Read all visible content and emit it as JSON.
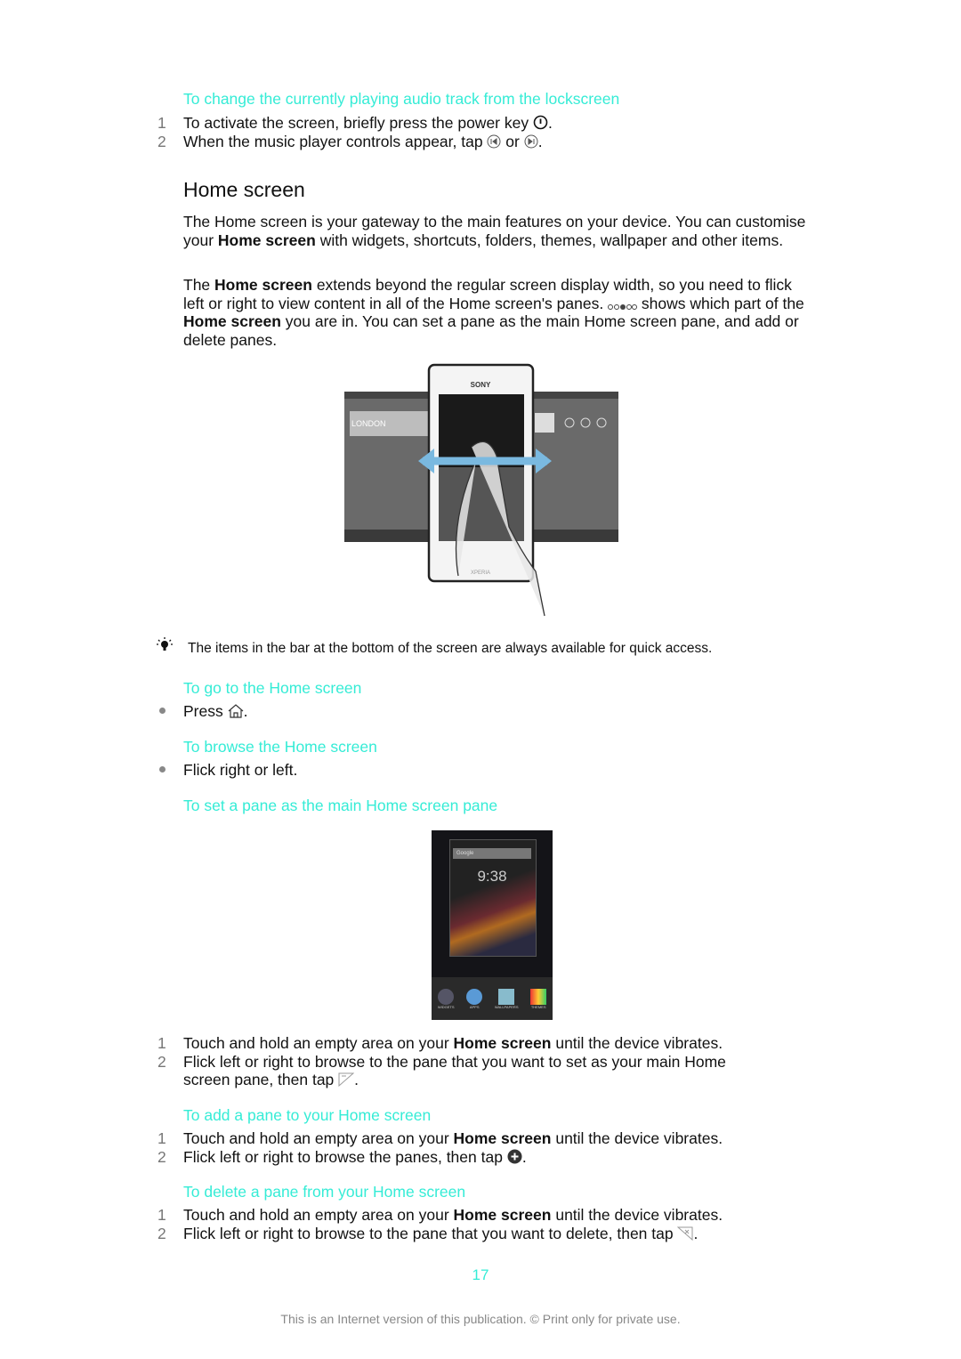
{
  "section1": {
    "heading": "To change the currently playing audio track from the lockscreen",
    "steps": [
      {
        "n": "1",
        "a": "To activate the screen, briefly press the power key ",
        "b": "."
      },
      {
        "n": "2",
        "a": "When the music player controls appear, tap ",
        "mid": " or ",
        "b": "."
      }
    ]
  },
  "home": {
    "title": "Home screen",
    "p1": [
      "The Home screen is your gateway to the main features on your device. You can customise your ",
      "Home screen",
      " with widgets, shortcuts, folders, themes, wallpaper and other items."
    ],
    "p2": [
      "The ",
      "Home screen",
      " extends beyond the regular screen display width, so you need to flick left or right to view content in all of the Home screen's panes. ",
      " shows which part of the ",
      "Home screen",
      " you are in. You can set a pane as the main Home screen pane, and add or delete panes."
    ],
    "illustration_brand": "SONY",
    "illustration_model": "XPERIA",
    "illustration_widget": "LONDON"
  },
  "tip": {
    "text": "The items in the bar at the bottom of the screen are always available for quick access."
  },
  "goHome": {
    "heading": "To go to the Home screen",
    "step_a": "Press ",
    "step_b": "."
  },
  "browse": {
    "heading": "To browse the Home screen",
    "step": "Flick right or left."
  },
  "setMain": {
    "heading": "To set a pane as the main Home screen pane",
    "screenshot": {
      "search": "Google",
      "clock": "9:38",
      "apps": [
        "WIDGETS",
        "APPS",
        "WALLPAPERS",
        "THEMES"
      ]
    },
    "steps": [
      {
        "n": "1",
        "a": "Touch and hold an empty area on your ",
        "bold": "Home screen",
        "b": " until the device vibrates."
      },
      {
        "n": "2",
        "a": "Flick left or right to browse to the pane that you want to set as your main Home",
        "a2": "screen pane, then tap ",
        "b": "."
      }
    ]
  },
  "addPane": {
    "heading": "To add a pane to your Home screen",
    "steps": [
      {
        "n": "1",
        "a": "Touch and hold an empty area on your ",
        "bold": "Home screen",
        "b": " until the device vibrates."
      },
      {
        "n": "2",
        "a": "Flick left or right to browse the panes, then tap ",
        "b": "."
      }
    ]
  },
  "deletePane": {
    "heading": "To delete a pane from your Home screen",
    "steps": [
      {
        "n": "1",
        "a": "Touch and hold an empty area on your ",
        "bold": "Home screen",
        "b": " until the device vibrates."
      },
      {
        "n": "2",
        "a": "Flick left or right to browse to the pane that you want to delete, then tap ",
        "b": "."
      }
    ]
  },
  "footer": {
    "page": "17",
    "notice": "This is an Internet version of this publication. © Print only for private use."
  },
  "colors": {
    "heading": "#35ecd6",
    "text": "#111111",
    "number": "#777777"
  }
}
